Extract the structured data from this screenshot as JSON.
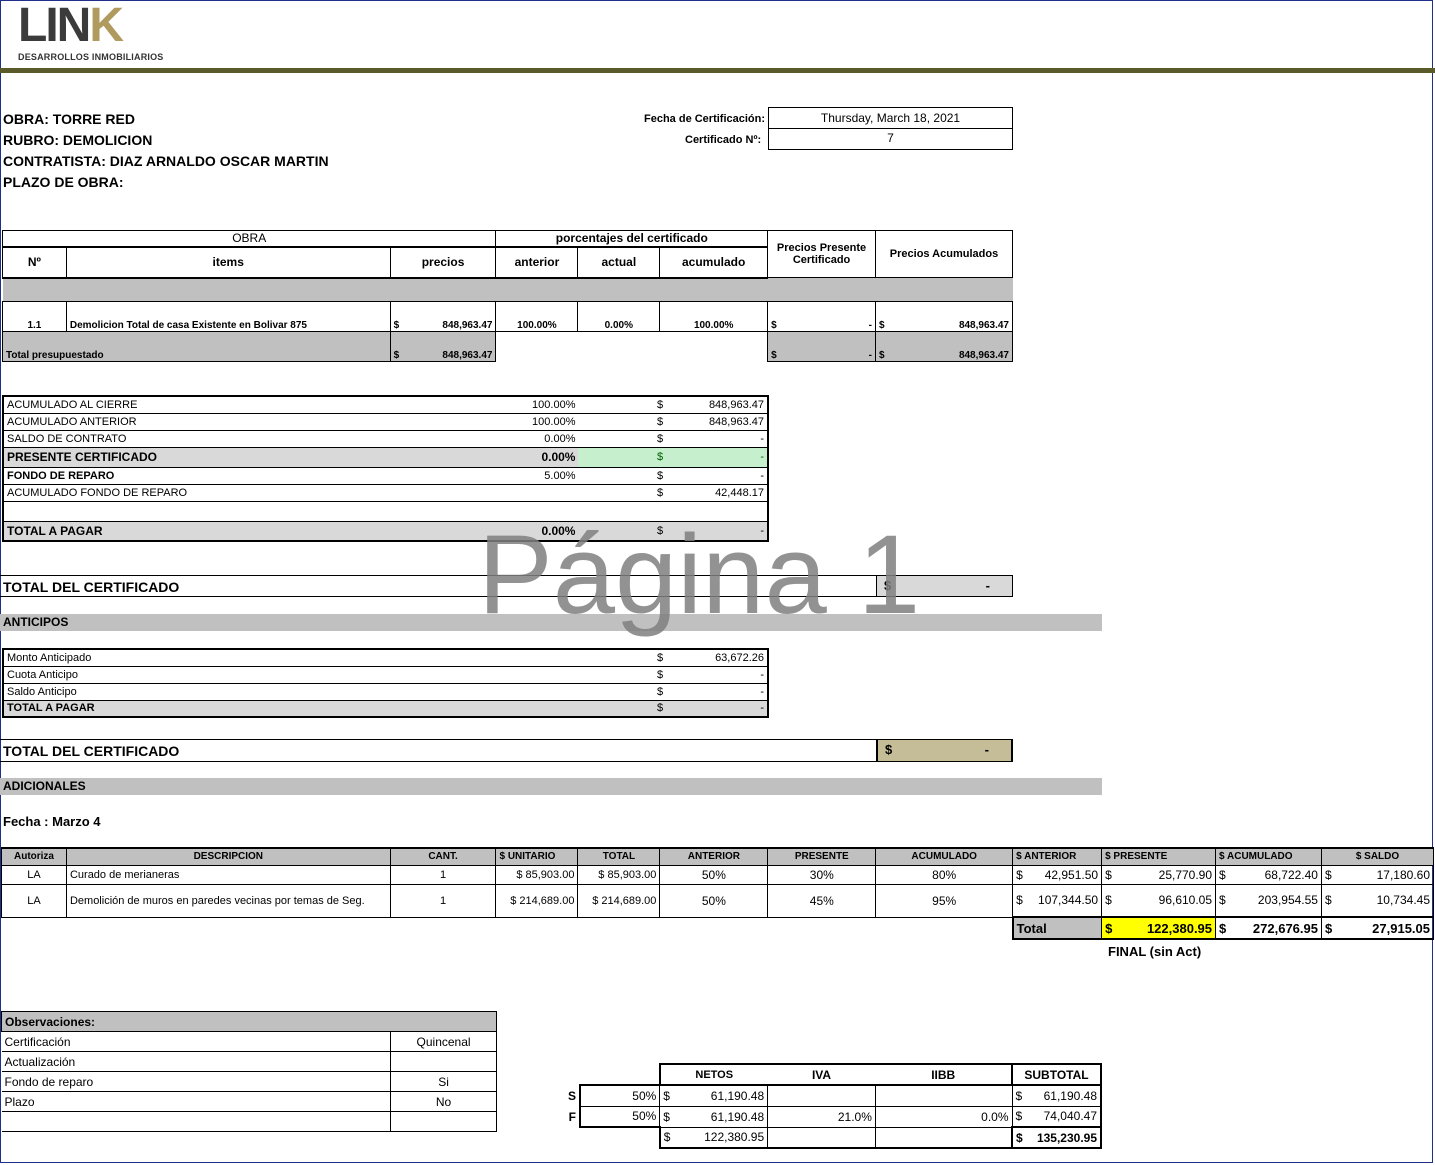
{
  "logo": {
    "word_dark": "LIN",
    "word_gold": "K",
    "subtitle": "DESARROLLOS INMOBILIARIOS"
  },
  "header": {
    "obra": "OBRA: TORRE RED",
    "rubro": "RUBRO: DEMOLICION",
    "contratista": "CONTRATISTA: DIAZ ARNALDO OSCAR MARTIN",
    "plazo": "PLAZO DE OBRA:",
    "fecha_label": "Fecha de Certificación:",
    "fecha_value": "Thursday, March 18, 2021",
    "cert_label": "Certificado Nº:",
    "cert_value": "7"
  },
  "main_table": {
    "group_obra": "OBRA",
    "group_pct": "porcentajes del certificado",
    "col_precios_presente": "Precios Presente Certificado",
    "col_precios_acum": "Precios Acumulados",
    "col_n": "Nº",
    "col_items": "items",
    "col_precios": "precios",
    "col_anterior": "anterior",
    "col_actual": "actual",
    "col_acumulado": "acumulado",
    "row": {
      "n": "1.1",
      "item": "Demolicion Total de casa Existente en Bolivar 875",
      "cur": "$",
      "precio": "848,963.47",
      "anterior": "100.00%",
      "actual": "0.00%",
      "acumulado": "100.00%",
      "presente": "-",
      "acum": "848,963.47"
    },
    "total_label": "Total presupuestado",
    "total_precio": "848,963.47",
    "total_presente": "-",
    "total_acum": "848,963.47"
  },
  "summary": {
    "rows": [
      {
        "label": "ACUMULADO AL CIERRE",
        "pct": "100.00%",
        "cur": "$",
        "val": "848,963.47"
      },
      {
        "label": "ACUMULADO ANTERIOR",
        "pct": "100.00%",
        "cur": "$",
        "val": "848,963.47"
      },
      {
        "label": "SALDO DE CONTRATO",
        "pct": "0.00%",
        "cur": "$",
        "val": "-"
      },
      {
        "label": "PRESENTE CERTIFICADO",
        "pct": "0.00%",
        "cur": "$",
        "val": "-"
      },
      {
        "label": "FONDO DE REPARO",
        "pct": "5.00%",
        "cur": "$",
        "val": "-"
      },
      {
        "label": "ACUMULADO FONDO DE REPARO",
        "pct": "",
        "cur": "$",
        "val": "42,448.17"
      },
      {
        "label": "TOTAL A PAGAR",
        "pct": "0.00%",
        "cur": "$",
        "val": "-"
      }
    ]
  },
  "total_cert_1": {
    "label": "TOTAL DEL CERTIFICADO",
    "cur": "$",
    "val": "-"
  },
  "watermark": "Página 1",
  "anticipos": {
    "title": "ANTICIPOS",
    "rows": [
      {
        "label": "Monto Anticipado",
        "cur": "$",
        "val": "63,672.26"
      },
      {
        "label": "Cuota Anticipo",
        "cur": "$",
        "val": "-"
      },
      {
        "label": "Saldo Anticipo",
        "cur": "$",
        "val": "-"
      },
      {
        "label": "TOTAL A PAGAR",
        "cur": "$",
        "val": "-"
      }
    ]
  },
  "total_cert_2": {
    "label": "TOTAL DEL CERTIFICADO",
    "cur": "$",
    "val": "-"
  },
  "adicionales": {
    "title": "ADICIONALES",
    "fecha": "Fecha :  Marzo 4",
    "headers": [
      "Autoriza",
      "DESCRIPCION",
      "CANT.",
      "$ UNITARIO",
      "TOTAL",
      "ANTERIOR",
      "PRESENTE",
      "ACUMULADO",
      "$ ANTERIOR",
      "$ PRESENTE",
      "$ ACUMULADO",
      "$ SALDO"
    ],
    "rows": [
      {
        "autoriza": "LA",
        "desc": "Curado de merianeras",
        "cant": "1",
        "unit": "$ 85,903.00",
        "total": "$ 85,903.00",
        "ant": "50%",
        "pres": "30%",
        "acum": "80%",
        "d_ant": "42,951.50",
        "d_pres": "25,770.90",
        "d_acum": "68,722.40",
        "d_saldo": "17,180.60"
      },
      {
        "autoriza": "LA",
        "desc": "Demolición de muros en paredes vecinas por temas de Seg.",
        "cant": "1",
        "unit": "$ 214,689.00",
        "total": "$ 214,689.00",
        "ant": "50%",
        "pres": "45%",
        "acum": "95%",
        "d_ant": "107,344.50",
        "d_pres": "96,610.05",
        "d_acum": "203,954.55",
        "d_saldo": "10,734.45"
      }
    ],
    "total_label": "Total",
    "total_pres": "122,380.95",
    "total_acum": "272,676.95",
    "total_saldo": "27,915.05",
    "final_note": "FINAL (sin Act)"
  },
  "observaciones": {
    "title": "Observaciones:",
    "rows": [
      {
        "label": "Certificación",
        "val": "Quincenal"
      },
      {
        "label": "Actualización",
        "val": ""
      },
      {
        "label": "Fondo de reparo",
        "val": "Si"
      },
      {
        "label": "Plazo",
        "val": "No"
      },
      {
        "label": "",
        "val": ""
      }
    ]
  },
  "netos": {
    "headers": [
      "NETOS",
      "IVA",
      "IIBB",
      "SUBTOTAL"
    ],
    "rows": [
      {
        "tag": "S",
        "pct": "50%",
        "neto": "61,190.48",
        "iva": "",
        "iibb": "",
        "sub": "61,190.48"
      },
      {
        "tag": "F",
        "pct": "50%",
        "neto": "61,190.48",
        "iva": "21.0%",
        "iibb": "0.0%",
        "sub": "74,040.47"
      },
      {
        "tag": "",
        "pct": "",
        "neto": "122,380.95",
        "iva": "",
        "iibb": "",
        "sub": "135,230.95"
      }
    ]
  }
}
